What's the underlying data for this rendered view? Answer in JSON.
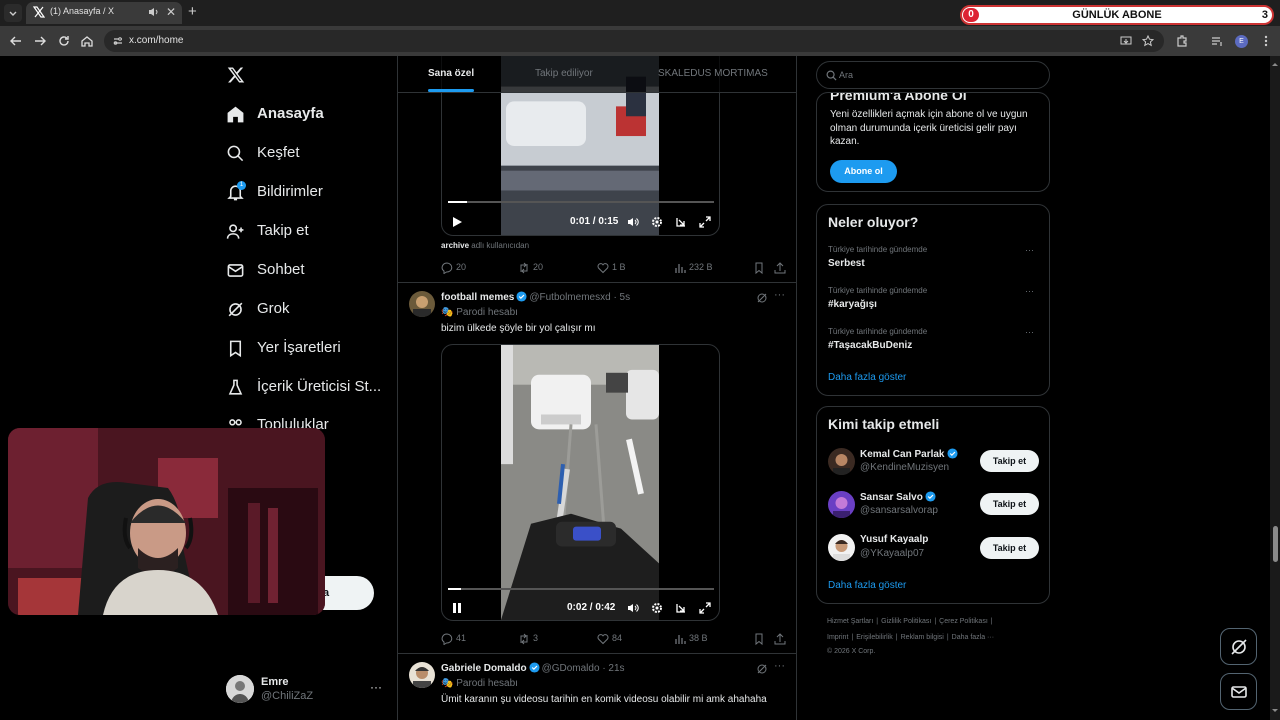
{
  "browser": {
    "tab_title": "(1) Anasayfa / X",
    "url": "x.com/home",
    "widget": {
      "left_count": "0",
      "title": "GÜNLÜK ABONE",
      "right_count": "3"
    },
    "profile_initial": "E"
  },
  "nav": {
    "items": [
      {
        "label": "Anasayfa",
        "icon": "home-icon",
        "active": true
      },
      {
        "label": "Keşfet",
        "icon": "search-icon"
      },
      {
        "label": "Bildirimler",
        "icon": "bell-icon",
        "badge": "1"
      },
      {
        "label": "Takip et",
        "icon": "person-add-icon"
      },
      {
        "label": "Sohbet",
        "icon": "mail-icon"
      },
      {
        "label": "Grok",
        "icon": "grok-icon"
      },
      {
        "label": "Yer İşaretleri",
        "icon": "bookmark-icon"
      },
      {
        "label": "İçerik Üreticisi St...",
        "icon": "flask-icon"
      },
      {
        "label": "Topluluklar",
        "icon": "people-icon"
      }
    ],
    "post_button": "la",
    "profile": {
      "name": "Emre",
      "handle": "@ChiliZaZ",
      "more": "···"
    }
  },
  "feed": {
    "tabs": [
      "Sana özel",
      "Takip ediliyor",
      "SKALEDUS MORTIMAS"
    ],
    "tweets": [
      {
        "video": {
          "time": "0:01 / 0:15",
          "progress": 0.07,
          "state": "paused"
        },
        "source_user": "archive",
        "source_text": "adlı kullanıcıdan",
        "stats": {
          "replies": "20",
          "reposts": "20",
          "likes": "1 B",
          "views": "232 B"
        }
      },
      {
        "name": "football memes",
        "handle": "@Futbolmemesxd",
        "time": "· 5s",
        "parody": "Parodi hesabı",
        "text": "bizim ülkede şöyle bir yol çalışır mı",
        "video": {
          "time": "0:02 / 0:42",
          "progress": 0.05,
          "state": "playing"
        },
        "stats": {
          "replies": "41",
          "reposts": "3",
          "likes": "84",
          "views": "38 B"
        }
      },
      {
        "name": "Gabriele Domaldo",
        "handle": "@GDomaldo",
        "time": "· 21s",
        "parody": "Parodi hesabı",
        "text": "Ümit karanın şu videosu tarihin en komik videosu olabilir mi amk ahahaha"
      }
    ]
  },
  "sidebar": {
    "search_placeholder": "Ara",
    "premium": {
      "title": "Premium'a Abone Ol",
      "text": "Yeni özellikleri açmak için abone ol ve uygun olman durumunda içerik üreticisi gelir payı kazan.",
      "button": "Abone ol"
    },
    "trends": {
      "title": "Neler oluyor?",
      "items": [
        {
          "context": "Türkiye tarihinde gündemde",
          "name": "Serbest"
        },
        {
          "context": "Türkiye tarihinde gündemde",
          "name": "#karyağışı"
        },
        {
          "context": "Türkiye tarihinde gündemde",
          "name": "#TaşacakBuDeniz"
        }
      ],
      "show_more": "Daha fazla göster"
    },
    "who_to_follow": {
      "title": "Kimi takip etmeli",
      "users": [
        {
          "name": "Kemal Can Parlak",
          "handle": "@KendineMuzisyen",
          "button": "Takip et"
        },
        {
          "name": "Sansar Salvo",
          "handle": "@sansarsalvorap",
          "button": "Takip et"
        },
        {
          "name": "Yusuf Kayaalp",
          "handle": "@YKayaalp07",
          "button": "Takip et"
        }
      ],
      "show_more": "Daha fazla göster"
    },
    "footer": {
      "row1": [
        "Hizmet Şartları",
        "|",
        "Gizlilik Politikası",
        "|",
        "Çerez Politikası",
        "|"
      ],
      "row2": [
        "Imprint",
        "|",
        "Erişilebilirlik",
        "|",
        "Reklam bilgisi",
        "|",
        "Daha fazla ···"
      ],
      "copyright": "© 2026 X Corp."
    }
  },
  "colors": {
    "accent": "#1d9bf0",
    "background": "#000000",
    "text": "#e7e9ea",
    "muted": "#71767b",
    "border": "#2f3336"
  }
}
